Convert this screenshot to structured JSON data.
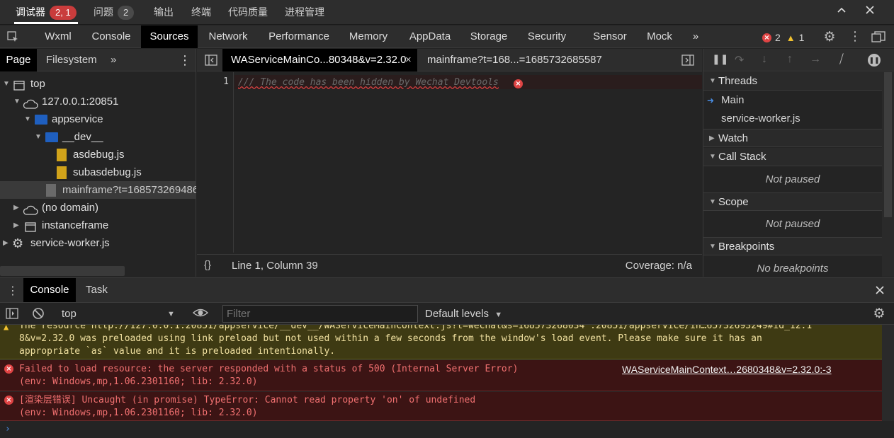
{
  "topbar": {
    "tabs": [
      "调试器",
      "问题",
      "输出",
      "终端",
      "代码质量",
      "进程管理"
    ],
    "debugger_badge": "2, 1",
    "problems_badge": "2"
  },
  "devtools_tabs": [
    "Wxml",
    "Console",
    "Sources",
    "Network",
    "Performance",
    "Memory",
    "AppData",
    "Storage",
    "Security",
    "Sensor",
    "Mock"
  ],
  "status_counts": {
    "errors": "2",
    "warnings": "1"
  },
  "navigator": {
    "tabs": [
      "Page",
      "Filesystem"
    ],
    "tree": [
      "top",
      "127.0.0.1:20851",
      "appservice",
      "__dev__",
      "asdebug.js",
      "subasdebug.js",
      "mainframe?t=168573269486",
      "(no domain)",
      "instanceframe",
      "service-worker.js"
    ]
  },
  "editor": {
    "tabs": [
      "WAServiceMainCo...80348&v=2.32.0",
      "mainframe?t=168...=1685732685587"
    ],
    "line_number": "1",
    "code_line": "/// The code has been hidden by Wechat Devtools",
    "status_position": "Line 1, Column 39",
    "coverage": "Coverage: n/a"
  },
  "debugger": {
    "threads_label": "Threads",
    "threads": [
      "Main",
      "service-worker.js"
    ],
    "watch_label": "Watch",
    "callstack_label": "Call Stack",
    "callstack_empty": "Not paused",
    "scope_label": "Scope",
    "scope_empty": "Not paused",
    "breakpoints_label": "Breakpoints",
    "breakpoints_empty": "No breakpoints"
  },
  "drawer": {
    "tabs": [
      "Console",
      "Task"
    ],
    "context": "top",
    "filter_placeholder": "Filter",
    "levels": "Default levels"
  },
  "messages": {
    "warning_line0": "The resource http://127.0.0.1:20851/appservice/__dev__/WAServiceMainContext.js?t=wechat&s=168573268034 :20851/appservice/in…65732693249#id_12:1",
    "warning_line1": "8&v=2.32.0 was preloaded using link preload but not used within a few seconds from the window's load event. Please make sure it has an",
    "warning_line2": "appropriate `as` value and it is preloaded intentionally.",
    "error1_line1": "Failed to load resource: the server responded with a status of 500 (Internal Server Error)",
    "error1_source": "WAServiceMainContext…2680348&v=2.32.0:-3",
    "error1_line2": "(env: Windows,mp,1.06.2301160; lib: 2.32.0)",
    "error2_line1": "[渲染层错误] Uncaught (in promise) TypeError: Cannot read property 'on' of undefined",
    "error2_line2": "(env: Windows,mp,1.06.2301160; lib: 2.32.0)"
  }
}
